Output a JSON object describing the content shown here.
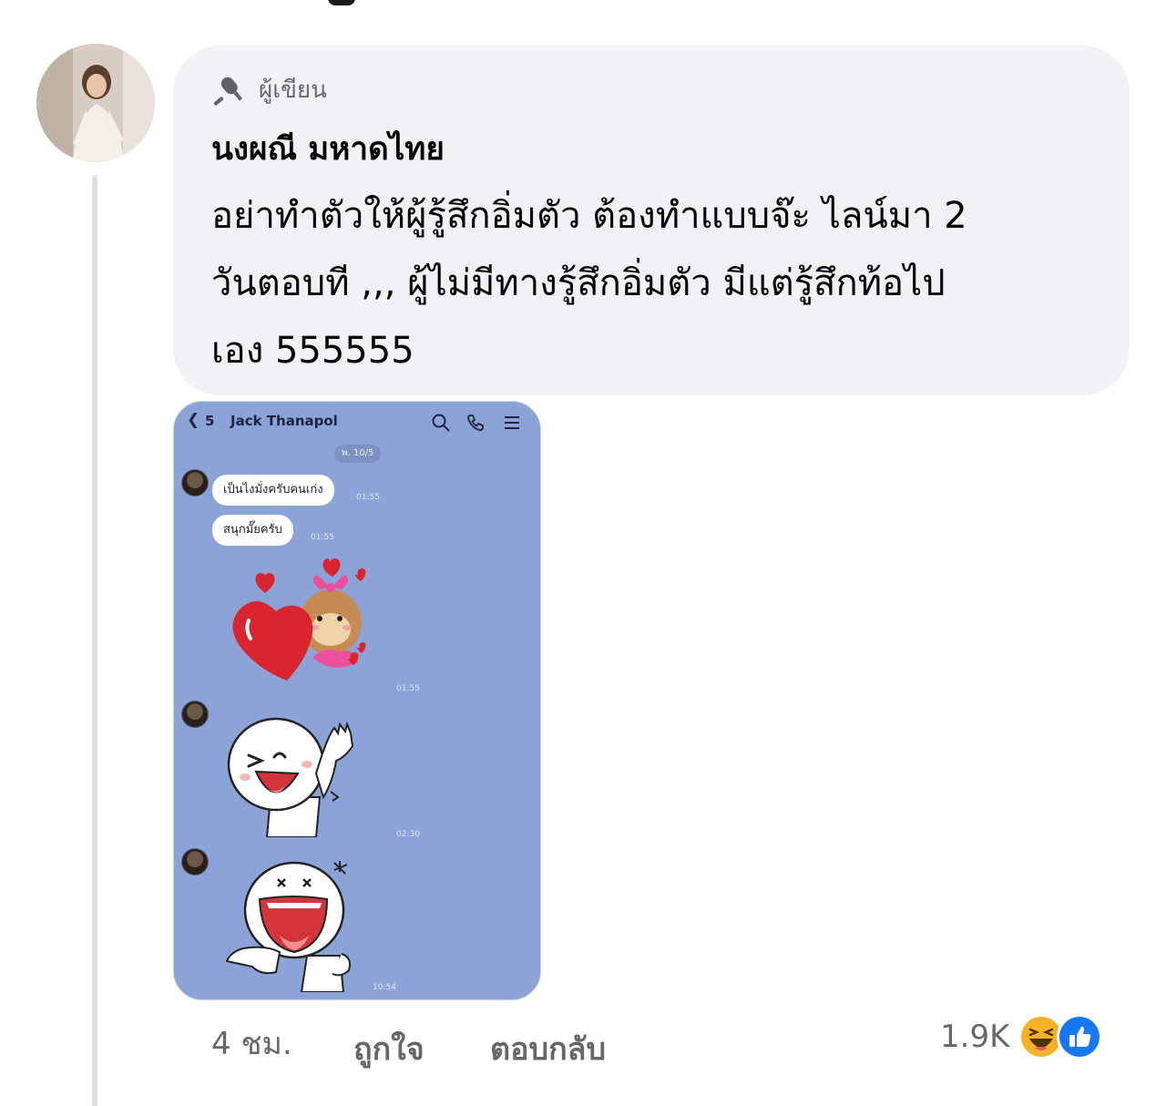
{
  "comment": {
    "author_badge": "ผู้เขียน",
    "author_name": "นงผณี มหาดไทย",
    "text_lines": [
      "อย่าทำตัวให้ผู้รู้สึกอิ่มตัว ต้องทำแบบจ๊ะ ไลน์มา 2",
      "วันตอบที ,,, ผู้ไม่มีทางรู้สึกอิ่มตัว มีแต่รู้สึกท้อไป",
      "เอง 555555"
    ]
  },
  "line_chat": {
    "back_count": "5",
    "contact_name": "Jack Thanapol",
    "date_pill": "พ. 10/5",
    "messages": [
      {
        "text": "เป็นไงมั่งครับคนเก่ง",
        "time": "01:55"
      },
      {
        "text": "สนุกมั๊ยครับ",
        "time": "01:55"
      }
    ],
    "sticker_times": [
      "01:55",
      "02:30",
      "10:54"
    ],
    "icons": [
      "search-icon",
      "phone-icon",
      "menu-icon"
    ]
  },
  "actions": {
    "time": "4 ชม.",
    "like_label": "ถูกใจ",
    "reply_label": "ตอบกลับ"
  },
  "reactions": {
    "count": "1.9K",
    "icons": [
      "haha-icon",
      "like-icon"
    ],
    "colors": {
      "haha": "#f7b125",
      "like": "#1877f2"
    }
  }
}
